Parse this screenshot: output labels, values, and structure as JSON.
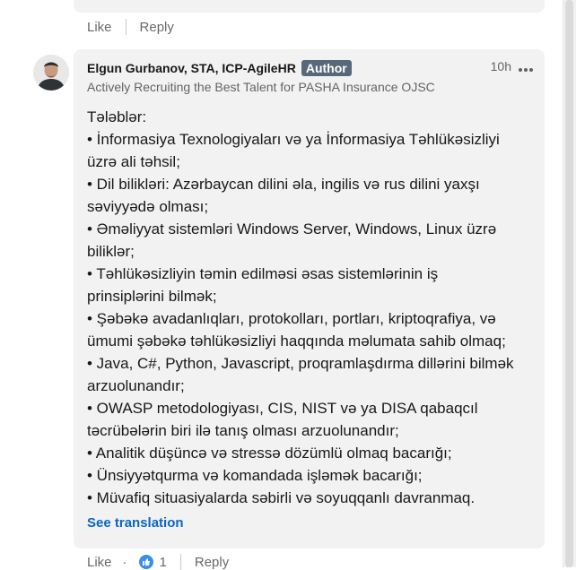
{
  "previous_comment": {
    "like_label": "Like",
    "reply_label": "Reply"
  },
  "comment": {
    "author_name": "Elgun Gurbanov, STA, ICP-AgileHR",
    "author_badge": "Author",
    "headline": "Actively Recruiting the Best Talent for PASHA Insurance OJSC",
    "time": "10h",
    "body_lines": [
      "Tələblər:",
      "• İnformasiya Texnologiyaları və ya İnformasiya Təhlükəsizliyi",
      "üzrə ali təhsil;",
      "• Dil bilikləri: Azərbaycan dilini əla, ingilis və rus dilini yaxşı",
      "səviyyədə olması;",
      "• Əməliyyat sistemləri Windows Server, Windows, Linux üzrə",
      "biliklər;",
      "• Təhlükəsizliyin təmin edilməsi əsas sistemlərinin iş",
      "prinsiplərini bilmək;",
      "• Şəbəkə avadanlıqları, protokolları, portları, kriptoqrafiya, və",
      "ümumi şəbəkə təhlükəsizliyi haqqında məlumata sahib olmaq;",
      "• Java, C#, Python, Javascript, proqramlaşdırma dillərini bilmək",
      "arzuolunandır;",
      "• OWASP metodologiyası, CIS, NIST və ya DISA qabaqcıl",
      "təcrübələrin biri ilə tanış olması arzuolunandır;",
      "• Analitik düşüncə və stressə dözümlü olmaq bacarığı;",
      "• Ünsiyyətqurma və komandada işləmək bacarığı;",
      "• Müvafiq situasiyalarda səbirli və soyuqqanlı davranmaq."
    ],
    "see_translation": "See translation",
    "like_label": "Like",
    "reaction_count": "1",
    "reply_label": "Reply",
    "reaction_icon": "like-hand-icon"
  },
  "colors": {
    "link": "#0a66c2",
    "badge": "#56687a",
    "card": "#f2f2f2",
    "reaction": "#378fe9"
  }
}
